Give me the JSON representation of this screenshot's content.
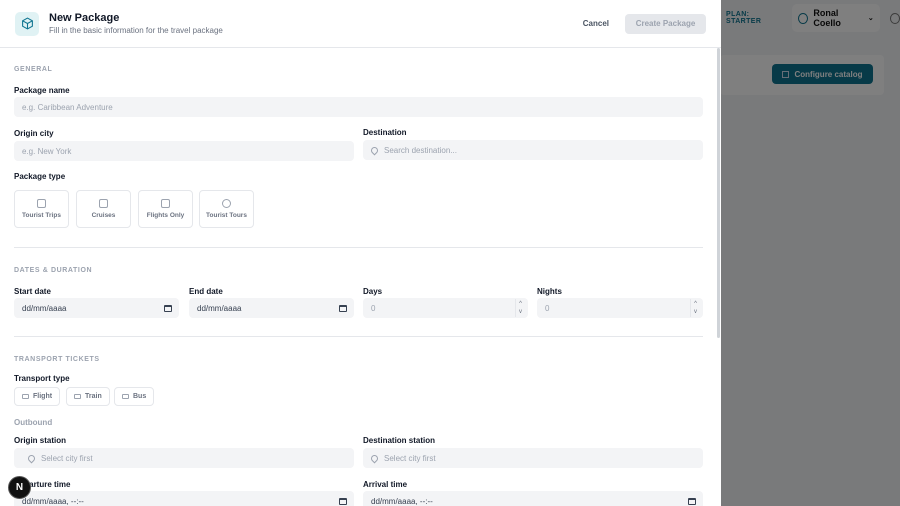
{
  "background": {
    "plan_label": "PLAN: STARTER",
    "user_name": "Ronal Coello",
    "configure_label": "Configure catalog"
  },
  "modal": {
    "title": "New Package",
    "subtitle": "Fill in the basic information for the travel package",
    "cancel_label": "Cancel",
    "create_label": "Create Package"
  },
  "general": {
    "section_title": "GENERAL",
    "package_name_label": "Package name",
    "package_name_placeholder": "e.g. Caribbean Adventure",
    "origin_label": "Origin city",
    "origin_placeholder": "e.g. New York",
    "destination_label": "Destination",
    "destination_placeholder": "Search destination...",
    "type_label": "Package type",
    "types": [
      "Tourist Trips",
      "Cruises",
      "Flights Only",
      "Tourist Tours"
    ]
  },
  "dates": {
    "section_title": "DATES & DURATION",
    "start_label": "Start date",
    "start_value": "dd/mm/aaaa",
    "end_label": "End date",
    "end_value": "dd/mm/aaaa",
    "days_label": "Days",
    "days_value": "0",
    "nights_label": "Nights",
    "nights_value": "0"
  },
  "transport": {
    "section_title": "TRANSPORT TICKETS",
    "type_label": "Transport type",
    "types": [
      "Flight",
      "Train",
      "Bus"
    ],
    "outbound_title": "Outbound",
    "origin_station_label": "Origin station",
    "origin_station_placeholder": "Select city first",
    "destination_station_label": "Destination station",
    "destination_station_placeholder": "Select city first",
    "departure_label": "Departure time",
    "departure_value": "dd/mm/aaaa, --:--",
    "arrival_label": "Arrival time",
    "arrival_value": "dd/mm/aaaa, --:--"
  },
  "badge": "N"
}
